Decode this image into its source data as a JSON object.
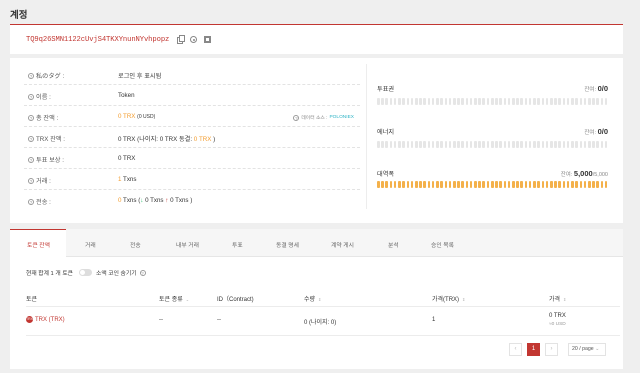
{
  "page": {
    "title": "계정"
  },
  "account": {
    "address": "TQ9q26SMN1122cUvjS4TKXYnunNYvhpopz"
  },
  "info": {
    "rows": [
      {
        "label": "私のタグ :",
        "value": "로그인 후 표시됨"
      },
      {
        "label": "이름 :",
        "value": "Token"
      },
      {
        "label": "총 잔액 :",
        "amount": "0 TRX",
        "sub": "(0 USD)",
        "source_label": "데이터 소스 :",
        "source_name": "POLONIEX"
      },
      {
        "label": "TRX 잔액 :",
        "prefix": "0 TRX (나이지: 0 TRX  동결: ",
        "frozen": "0 TRX",
        "suffix": " )"
      },
      {
        "label": "투표 보상 :",
        "value": "0 TRX"
      },
      {
        "label": "거래 :",
        "count": "1",
        "unit": " Txns"
      },
      {
        "label": "전송 :",
        "count": "0",
        "unit": " Txns (",
        "in_arrow": "↓",
        "in": " 0 Txns ",
        "out_arrow": "↑",
        "out": " 0 Txns )"
      }
    ]
  },
  "resources": {
    "vote": {
      "label": "투표권",
      "remaining_label": "잔여: ",
      "value": "0/0"
    },
    "energy": {
      "label": "에너지",
      "remaining_label": "잔여: ",
      "value": "0/0"
    },
    "bandwidth": {
      "label": "대역폭",
      "remaining_label": "잔여: ",
      "value": "5,000",
      "total": "/5,000",
      "fill_fraction": 1.0
    }
  },
  "tabs": [
    "토큰 잔액",
    "거래",
    "전송",
    "내부 거래",
    "투표",
    "동결 명세",
    "계약 게시",
    "분석",
    "승인 목록"
  ],
  "tokens_section": {
    "total_text": "현재 합계 1 개 토큰",
    "hide_small_label": "소액 코인 숨기기",
    "columns": [
      "토큰",
      "토큰 종류",
      "ID（Contract)",
      "수량",
      "가격(TRX)",
      "가격"
    ],
    "rows": [
      {
        "icon": "TRX",
        "token": "TRX (TRX)",
        "type": "--",
        "id": "--",
        "quantity": "0 (나이지: 0)",
        "price_trx": "1",
        "price": "0 TRX",
        "price_usd": "≈0 USD"
      }
    ]
  },
  "pagination": {
    "prev": "‹",
    "current": "1",
    "next": "›",
    "page_size": "20 / page"
  },
  "colors": {
    "brand": "#c23631",
    "accent": "#f39c2e",
    "bar": "#f4b14b",
    "link": "#2fb4c6"
  },
  "icons": [
    "copy-icon",
    "hide-icon",
    "qr-code-icon",
    "question-icon",
    "sort-icon"
  ]
}
